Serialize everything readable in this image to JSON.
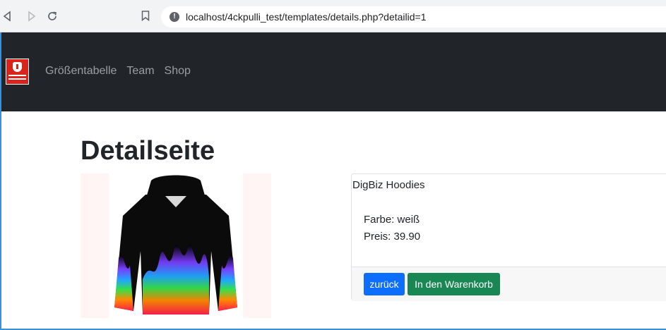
{
  "browser": {
    "url": "localhost/4ckpulli_test/templates/details.php?detailid=1",
    "back_icon": "back-arrow-icon",
    "forward_icon": "forward-arrow-icon",
    "reload_icon": "reload-icon",
    "bookmark_icon": "bookmark-icon",
    "info_icon": "info-icon"
  },
  "navbar": {
    "brand_logo": "school-crest-logo",
    "links": [
      {
        "label": "Größentabelle"
      },
      {
        "label": "Team"
      },
      {
        "label": "Shop"
      }
    ],
    "background": "#212529"
  },
  "page": {
    "title": "Detailseite"
  },
  "product": {
    "image": "hoodie-rainbow-flames-image",
    "name": "DigBiz Hoodies",
    "color_line": "Farbe: weiß",
    "price_line": "Preis: 39.90"
  },
  "actions": {
    "back_label": "zurück",
    "cart_label": "In den Warenkorb",
    "back_color": "#0d6efd",
    "cart_color": "#198754"
  }
}
